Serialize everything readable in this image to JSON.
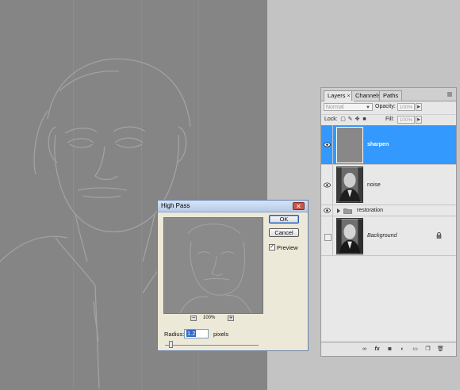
{
  "layers_panel": {
    "tabs": [
      {
        "label": "Layers",
        "close": "×"
      },
      {
        "label": "Channels"
      },
      {
        "label": "Paths"
      }
    ],
    "blend_mode": "Normal",
    "opacity_label": "Opacity:",
    "opacity_value": "100%",
    "lock_label": "Lock:",
    "fill_label": "Fill:",
    "fill_value": "100%",
    "layers": [
      {
        "name": "sharpen",
        "visible": true,
        "selected": true
      },
      {
        "name": "noise",
        "visible": true,
        "selected": false
      },
      {
        "name": "restoration",
        "visible": true,
        "selected": false,
        "type": "group"
      },
      {
        "name": "Background",
        "visible": false,
        "selected": false,
        "locked": true
      }
    ],
    "bottom_icons": [
      "link-icon",
      "fx-icon",
      "mask-icon",
      "adjustment-icon",
      "group-icon",
      "new-layer-icon",
      "trash-icon"
    ],
    "fx_label": "fx"
  },
  "dialog": {
    "title": "High Pass",
    "ok_label": "OK",
    "cancel_label": "Cancel",
    "preview_label": "Preview",
    "preview_checked": true,
    "zoom_minus": "−",
    "zoom_plus": "+",
    "zoom_value": "100%",
    "radius_label": "Radius:",
    "radius_value": "1.2",
    "radius_unit": "pixels",
    "slider_value": 0.05
  }
}
